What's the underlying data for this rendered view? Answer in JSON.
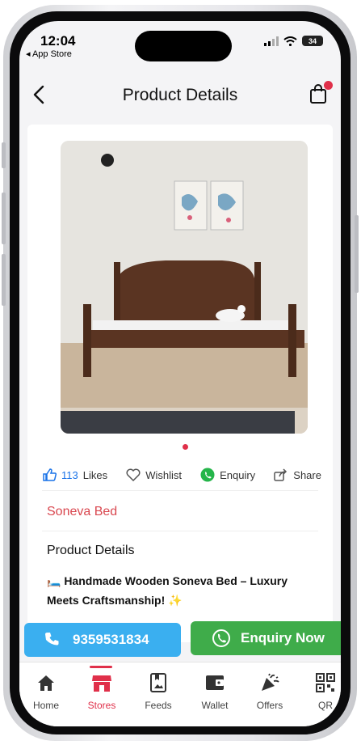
{
  "status": {
    "time": "12:04",
    "back_label": "◂ App Store",
    "battery": "34"
  },
  "header": {
    "title": "Product Details"
  },
  "actions": {
    "likes_count": "113",
    "likes_label": "Likes",
    "wishlist_label": "Wishlist",
    "enquiry_label": "Enquiry",
    "share_label": "Share"
  },
  "product": {
    "name": "Soneva Bed",
    "details_heading": "Product Details",
    "description": "🛏️ Handmade Wooden Soneva Bed – Luxury Meets Craftsmanship! ✨"
  },
  "buttons": {
    "phone": "9359531834",
    "enquiry_now": "Enquiry Now"
  },
  "tabs": [
    {
      "label": "Home",
      "icon": "home-icon"
    },
    {
      "label": "Stores",
      "icon": "store-icon",
      "active": true
    },
    {
      "label": "Feeds",
      "icon": "feeds-icon"
    },
    {
      "label": "Wallet",
      "icon": "wallet-icon"
    },
    {
      "label": "Offers",
      "icon": "party-popper-icon"
    },
    {
      "label": "QR",
      "icon": "qr-icon"
    }
  ],
  "colors": {
    "accent": "#e0304a",
    "call_button": "#3aaff0",
    "whatsapp_button": "#3fac4a",
    "like_blue": "#1a73e8"
  }
}
